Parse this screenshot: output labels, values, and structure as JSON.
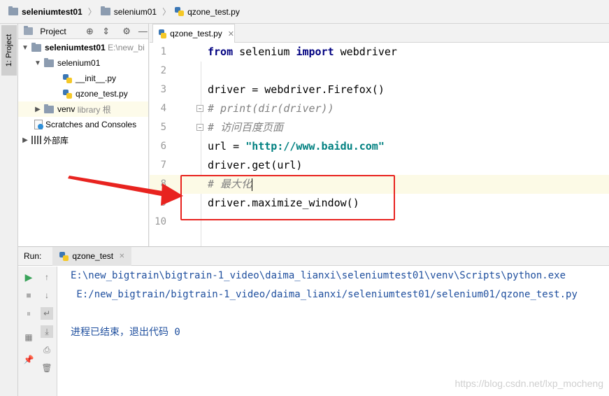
{
  "breadcrumb": {
    "items": [
      "seleniumtest01",
      "selenium01",
      "qzone_test.py"
    ]
  },
  "left_stripe": {
    "project_tab": "1: Project"
  },
  "project_panel": {
    "header_label": "Project",
    "tree": [
      {
        "label": "seleniumtest01",
        "suffix": "E:\\new_bi",
        "expanded": true
      },
      {
        "label": "selenium01",
        "expanded": true
      },
      {
        "label": "__init__.py"
      },
      {
        "label": "qzone_test.py"
      },
      {
        "label": "venv",
        "suffix": "library 根",
        "expanded": false
      },
      {
        "label": "Scratches and Consoles"
      },
      {
        "label": "外部库",
        "expanded": false
      }
    ]
  },
  "editor": {
    "tab_label": "qzone_test.py",
    "lines": [
      {
        "n": "1"
      },
      {
        "n": "2"
      },
      {
        "n": "3"
      },
      {
        "n": "4"
      },
      {
        "n": "5"
      },
      {
        "n": "6"
      },
      {
        "n": "7"
      },
      {
        "n": "8"
      },
      {
        "n": "9"
      },
      {
        "n": "10"
      }
    ],
    "code": {
      "l1_kw1": "from",
      "l1_mid": " selenium ",
      "l1_kw2": "import",
      "l1_end": " webdriver",
      "l3": "driver = webdriver.Firefox()",
      "l4": "# print(dir(driver))",
      "l5": "# 访问百度页面",
      "l6_pre": "url = ",
      "l6_str": "\"http://www.baidu.com\"",
      "l7": "driver.get(url)",
      "l8": "# 最大化",
      "l9": "driver.maximize_window()"
    }
  },
  "run_panel": {
    "label": "Run:",
    "tab_label": "qzone_test",
    "console": [
      "E:\\new_bigtrain\\bigtrain-1_video\\daima_lianxi\\seleniumtest01\\venv\\Scripts\\python.exe",
      " E:/new_bigtrain/bigtrain-1_video/daima_lianxi/seleniumtest01/selenium01/qzone_test.py",
      "进程已结束，退出代码 0"
    ]
  },
  "watermark": "https://blog.csdn.net/lxp_mocheng",
  "colors": {
    "keyword": "#000080",
    "string": "#008080",
    "comment": "#808080",
    "annotation_red": "#e8231f",
    "console_text": "#1f4f9e"
  }
}
